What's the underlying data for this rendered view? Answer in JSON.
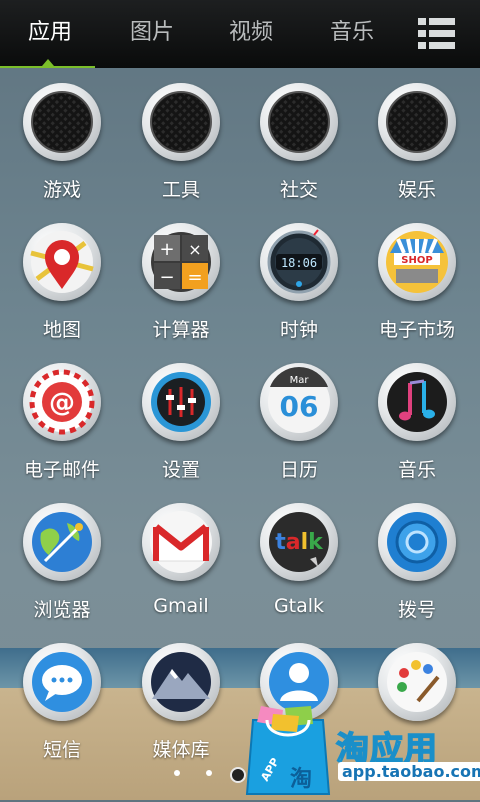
{
  "tabs": [
    {
      "label": "应用",
      "active": true
    },
    {
      "label": "图片",
      "active": false
    },
    {
      "label": "视频",
      "active": false
    },
    {
      "label": "音乐",
      "active": false
    }
  ],
  "menu_icon": "list-menu-icon",
  "apps": [
    {
      "label": "游戏",
      "icon": "game-folder-icon"
    },
    {
      "label": "工具",
      "icon": "tools-folder-icon"
    },
    {
      "label": "社交",
      "icon": "social-folder-icon"
    },
    {
      "label": "娱乐",
      "icon": "entertainment-folder-icon"
    },
    {
      "label": "地图",
      "icon": "map-pin-icon"
    },
    {
      "label": "计算器",
      "icon": "calculator-icon"
    },
    {
      "label": "时钟",
      "icon": "clock-icon",
      "clock_text": "18:06"
    },
    {
      "label": "电子市场",
      "icon": "shop-icon",
      "sign_text": "SHOP"
    },
    {
      "label": "电子邮件",
      "icon": "email-at-icon"
    },
    {
      "label": "设置",
      "icon": "settings-sliders-icon"
    },
    {
      "label": "日历",
      "icon": "calendar-icon",
      "month": "Mar",
      "day": "06"
    },
    {
      "label": "音乐",
      "icon": "music-note-icon"
    },
    {
      "label": "浏览器",
      "icon": "browser-globe-icon"
    },
    {
      "label": "Gmail",
      "icon": "gmail-envelope-icon"
    },
    {
      "label": "Gtalk",
      "icon": "gtalk-bubble-icon",
      "badge": "talk"
    },
    {
      "label": "拨号",
      "icon": "dialer-icon"
    },
    {
      "label": "短信",
      "icon": "sms-bubble-icon"
    },
    {
      "label": "媒体库",
      "icon": "gallery-mountain-icon"
    },
    {
      "label": "",
      "icon": "contacts-person-icon"
    },
    {
      "label": "",
      "icon": "paint-palette-icon"
    }
  ],
  "page_indicator": {
    "count": 3,
    "active_index": 2
  },
  "overlay": {
    "brand": "淘应用",
    "url": "app.taobao.com",
    "bag_text": "APP",
    "bag_logo": "淘"
  },
  "colors": {
    "accent": "#7bbf2a",
    "brand_blue": "#1a8fc9"
  }
}
